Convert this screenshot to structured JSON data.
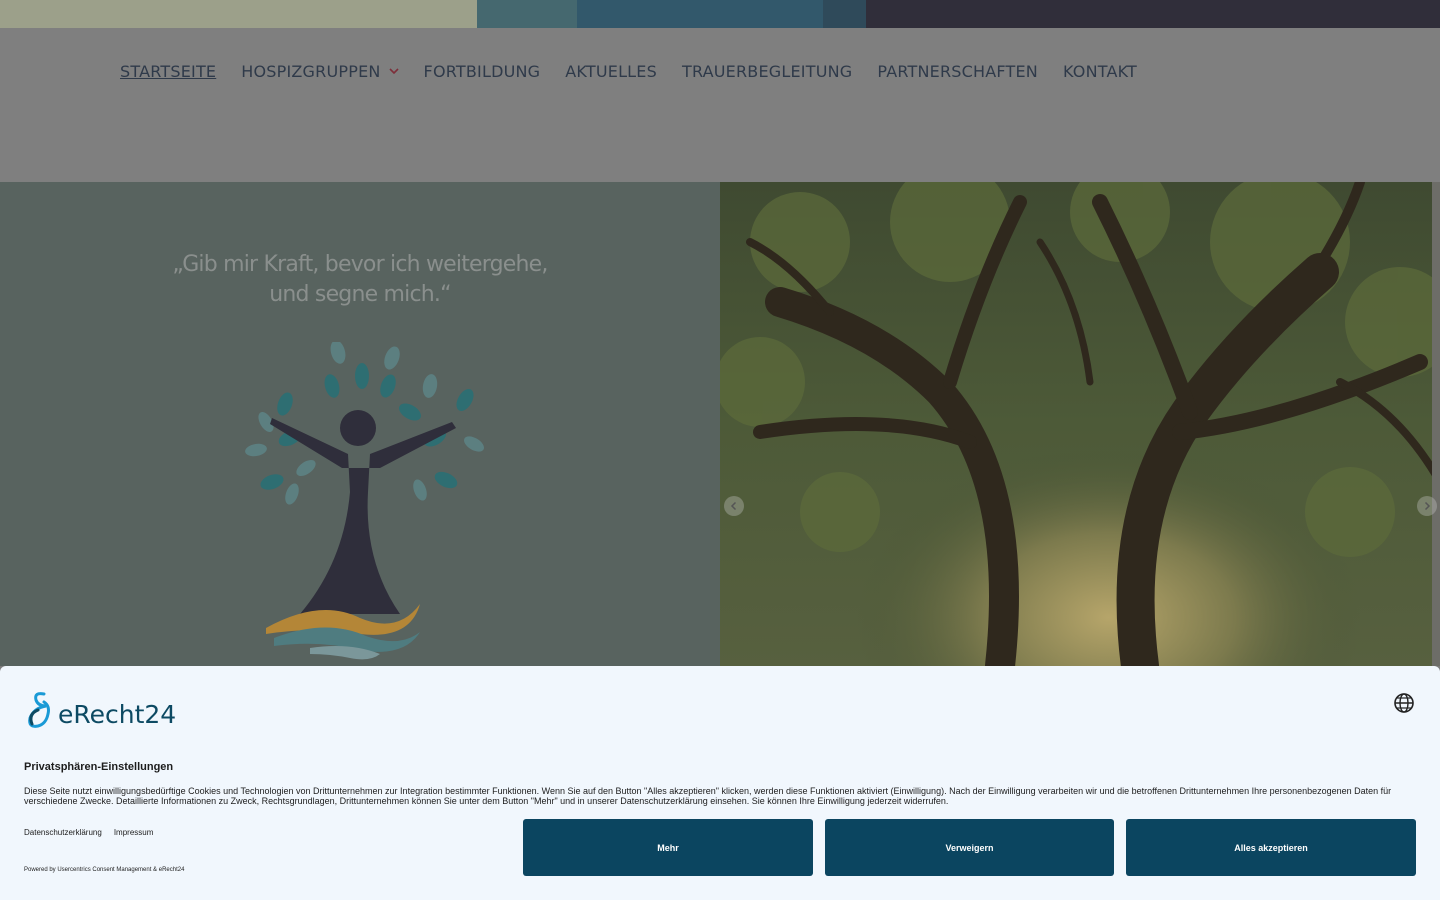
{
  "colors": {
    "strip": [
      "#9ca08a",
      "#45686f",
      "#32586b",
      "#2f4a5a",
      "#302e3a"
    ],
    "nav_text": "#2f3a4a",
    "nav_chevron": "#7d2e3a",
    "hero_left_bg": "#58635f",
    "consent_button": "#0b4560",
    "brand": "#0d4a63"
  },
  "nav": {
    "items": [
      {
        "label": "STARTSEITE",
        "active": true
      },
      {
        "label": "HOSPIZGRUPPEN",
        "has_dropdown": true
      },
      {
        "label": "FORTBILDUNG"
      },
      {
        "label": "AKTUELLES"
      },
      {
        "label": "TRAUERBEGLEITUNG"
      },
      {
        "label": "PARTNERSCHAFTEN"
      },
      {
        "label": "KONTAKT"
      }
    ],
    "dropdown_icon": "chevron-down-icon"
  },
  "hero": {
    "quote_line1": "„Gib mir Kraft, bevor ich weitergehe,",
    "quote_line2": "und segne mich.“",
    "logo_icon": "person-tree-logo-icon",
    "slider_prev_icon": "chevron-left-icon",
    "slider_next_icon": "chevron-right-icon"
  },
  "consent": {
    "brand": "eRecht24",
    "language_icon": "globe-icon",
    "title": "Privatsphären-Einstellungen",
    "text": "Diese Seite nutzt einwilligungsbedürftige Cookies und Technologien von Drittunternehmen zur Integration bestimmter Funktionen. Wenn Sie auf den Button \"Alles akzeptieren\" klicken, werden diese Funktionen aktiviert (Einwilligung). Nach der Einwilligung verarbeiten wir und die betroffenen Drittunternehmen Ihre personenbezogenen Daten für verschiedene Zwecke. Detaillierte Informationen zu Zweck, Rechtsgrundlagen, Drittunternehmen können Sie unter dem Button \"Mehr\" und in unserer Datenschutzerklärung einsehen. Sie können Ihre Einwilligung jederzeit widerrufen.",
    "link_privacy": "Datenschutzerklärung",
    "link_imprint": "Impressum",
    "powered": "Powered by Usercentrics Consent Management & eRecht24",
    "btn_more": "Mehr",
    "btn_deny": "Verweigern",
    "btn_accept": "Alles akzeptieren"
  }
}
